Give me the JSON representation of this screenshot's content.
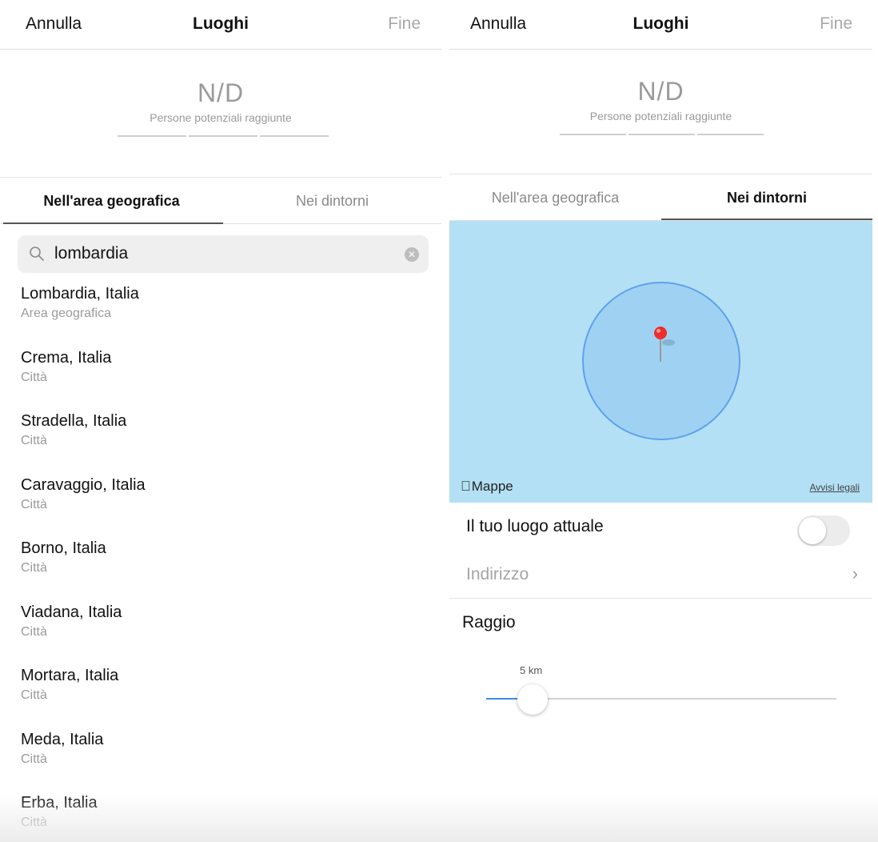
{
  "left": {
    "nav": {
      "cancel_label": "Annulla",
      "title": "Luoghi",
      "done_label": "Fine"
    },
    "reach": {
      "value": "N/D",
      "label": "Persone potenziali raggiunte"
    },
    "tabs": [
      {
        "label": "Nell'area geografica",
        "active": true
      },
      {
        "label": "Nei dintorni",
        "active": false
      }
    ],
    "search": {
      "value": "lombardia",
      "icon": "search-icon"
    },
    "results": [
      {
        "name": "Lombardia, Italia",
        "type": "Area geografica"
      },
      {
        "name": "Crema, Italia",
        "type": "Città"
      },
      {
        "name": "Stradella, Italia",
        "type": "Città"
      },
      {
        "name": "Caravaggio, Italia",
        "type": "Città"
      },
      {
        "name": "Borno, Italia",
        "type": "Città"
      },
      {
        "name": "Viadana, Italia",
        "type": "Città"
      },
      {
        "name": "Mortara, Italia",
        "type": "Città"
      },
      {
        "name": "Meda, Italia",
        "type": "Città"
      },
      {
        "name": "Erba, Italia",
        "type": "Città"
      }
    ]
  },
  "right": {
    "nav": {
      "cancel_label": "Annulla",
      "title": "Luoghi",
      "done_label": "Fine"
    },
    "reach": {
      "value": "N/D",
      "label": "Persone potenziali raggiunte"
    },
    "tabs": [
      {
        "label": "Nell'area geografica",
        "active": false
      },
      {
        "label": "Nei dintorni",
        "active": true
      }
    ],
    "map": {
      "brand": "Mappe",
      "legal_link": "Avvisi legali",
      "water_color": "#b3e0f4",
      "radius_color": "#5ea1ec"
    },
    "current_location": {
      "label": "Il tuo luogo attuale",
      "enabled": false
    },
    "address": {
      "placeholder": "Indirizzo"
    },
    "radius": {
      "title": "Raggio",
      "value_label": "5 km",
      "value_km": 5
    }
  },
  "colors": {
    "muted": "#9a9a9a",
    "accent": "#3d8ede"
  }
}
